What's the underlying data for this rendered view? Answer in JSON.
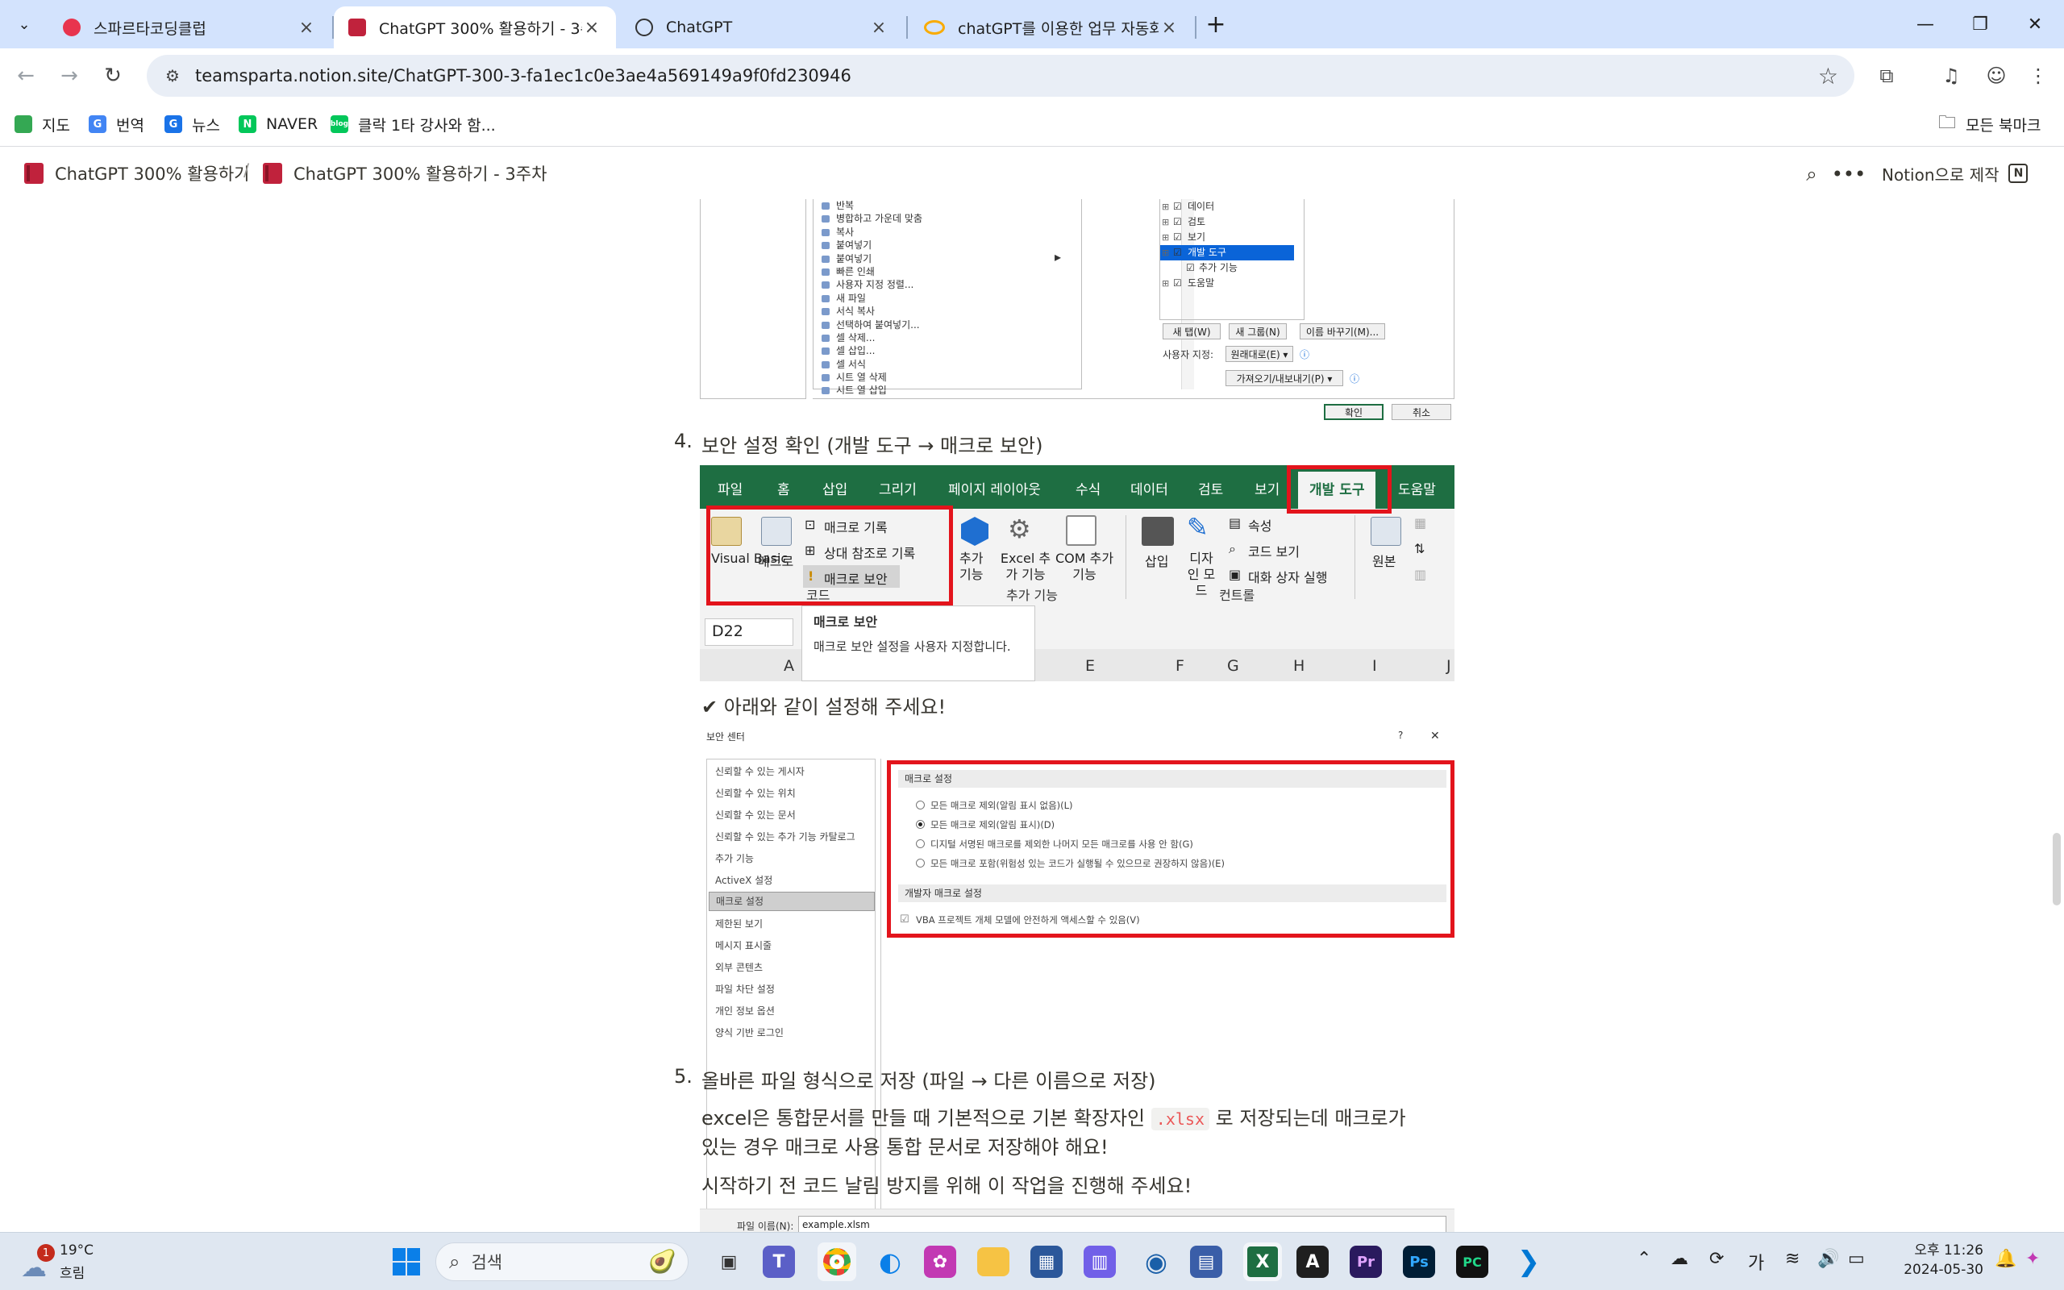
{
  "browser": {
    "tabs": [
      {
        "title": "스파르타코딩클럽",
        "favicon": "heart-logo-icon",
        "active": false
      },
      {
        "title": "ChatGPT 300% 활용하기 - 3주",
        "favicon": "notion-book-icon",
        "active": true
      },
      {
        "title": "ChatGPT",
        "favicon": "openai-icon",
        "active": false
      },
      {
        "title": "chatGPT를 이용한 업무 자동화",
        "favicon": "colab-icon",
        "active": false
      }
    ],
    "url": "teamsparta.notion.site/ChatGPT-300-3-fa1ec1c0e3ae4a569149a9f0fd230946",
    "bookmarks": [
      {
        "label": "지도",
        "icon": "maps-icon",
        "color": "#34a853"
      },
      {
        "label": "번역",
        "icon": "translate-icon",
        "color": "#4285f4"
      },
      {
        "label": "뉴스",
        "icon": "news-icon",
        "color": "#1a73e8"
      },
      {
        "label": "NAVER",
        "icon": "naver-icon",
        "color": "#03c75a"
      },
      {
        "label": "클락 1타 강사와 함...",
        "icon": "blog-icon",
        "color": "#03c75a"
      }
    ],
    "all_bookmarks": "모든 북마크"
  },
  "notion": {
    "breadcrumb": [
      "ChatGPT 300% 활용하기",
      "ChatGPT 300% 활용하기 - 3주차"
    ],
    "made_with": "Notion으로 제작"
  },
  "content": {
    "step4_num": "4.",
    "step4": "보안 설정 확인 (개발 도구 → 매크로 보안)",
    "check_line": "✔ 아래와 같이 설정해 주세요!",
    "step5_num": "5.",
    "step5": "올바른 파일 형식으로 저장 (파일 → 다른 이름으로 저장)",
    "para1_a": "excel은 통합문서를 만들 때 기본적으로 기본 확장자인",
    "para1_code": ".xlsx",
    "para1_b": "로 저장되는데 매크로가",
    "para1_c": "있는 경우 매크로 사용 통합 문서로 저장해야 해요!",
    "para2": "시작하기 전 코드 날림 방지를 위해 이 작업을 진행해 주세요!"
  },
  "options_dialog": {
    "commands": [
      "반복",
      "병합하고 가운데 맞춤",
      "복사",
      "붙여넣기",
      "붙여넣기",
      "빠른 인쇄",
      "사용자 지정 정렬...",
      "새 파일",
      "서식 복사",
      "선택하여 붙여넣기...",
      "셀 삭제...",
      "셀 삽입...",
      "셀 서식",
      "시트 열 삭제",
      "시트 열 삽입"
    ],
    "tabs": [
      "데이터",
      "검토",
      "보기",
      "개발 도구",
      "추가 기능",
      "도움말"
    ],
    "selected_tab": "개발 도구",
    "btn_new_tab": "새 탭(W)",
    "btn_new_group": "새 그룹(N)",
    "btn_rename": "이름 바꾸기(M)...",
    "customize_label": "사용자 지정:",
    "customize_value": "원래대로(E) ▾",
    "import_export": "가져오기/내보내기(P) ▾",
    "ok": "확인",
    "cancel": "취소"
  },
  "ribbon": {
    "menu": [
      "파일",
      "홈",
      "삽입",
      "그리기",
      "페이지 레이아웃",
      "수식",
      "데이터",
      "검토",
      "보기",
      "개발 도구",
      "도움말"
    ],
    "visual_basic": "Visual Basic",
    "macro": "매크로",
    "record_macro": "매크로 기록",
    "relative_ref": "상대 참조로 기록",
    "macro_security": "매크로 보안",
    "group_code": "코드",
    "addins": "추가 기능",
    "excel_addins": "Excel 추가 기능",
    "com_addins": "COM 추가 기능",
    "group_addins": "추가 기능",
    "insert": "삽입",
    "design_mode": "디자인 모드",
    "properties": "속성",
    "view_code": "코드 보기",
    "run_dialog": "대화 상자 실행",
    "group_controls": "컨트롤",
    "source": "원본",
    "name_box": "D22",
    "tooltip_title": "매크로 보안",
    "tooltip_body": "매크로 보안 설정을 사용자 지정합니다.",
    "columns": [
      "A",
      "E",
      "F",
      "G",
      "H",
      "I",
      "J"
    ]
  },
  "trust_center": {
    "title": "보안 센터",
    "help": "?",
    "close": "✕",
    "nav": [
      "신뢰할 수 있는 게시자",
      "신뢰할 수 있는 위치",
      "신뢰할 수 있는 문서",
      "신뢰할 수 있는 추가 기능 카탈로그",
      "추가 기능",
      "ActiveX 설정",
      "매크로 설정",
      "제한된 보기",
      "메시지 표시줄",
      "외부 콘텐츠",
      "파일 차단 설정",
      "개인 정보 옵션",
      "양식 기반 로그인"
    ],
    "selected_nav": "매크로 설정",
    "section_macro": "매크로 설정",
    "options": [
      "모든 매크로 제외(알림 표시 없음)(L)",
      "모든 매크로 제외(알림 표시)(D)",
      "디지털 서명된 매크로를 제외한 나머지 모든 매크로를 사용 안 함(G)",
      "모든 매크로 포함(위험성 있는 코드가 실행될 수 있으므로 권장하지 않음)(E)"
    ],
    "selected_option": 1,
    "section_dev": "개발자 매크로 설정",
    "vba_option": "VBA 프로젝트 개체 모델에 안전하게 액세스할 수 있음(V)"
  },
  "save_dialog": {
    "filename_label": "파일 이름(N):",
    "filename_value": "example.xlsm"
  },
  "taskbar": {
    "weather_temp": "19°C",
    "weather_desc": "흐림",
    "weather_badge": "1",
    "search": "검색",
    "ime": "가",
    "time": "오후 11:26",
    "date": "2024-05-30"
  }
}
